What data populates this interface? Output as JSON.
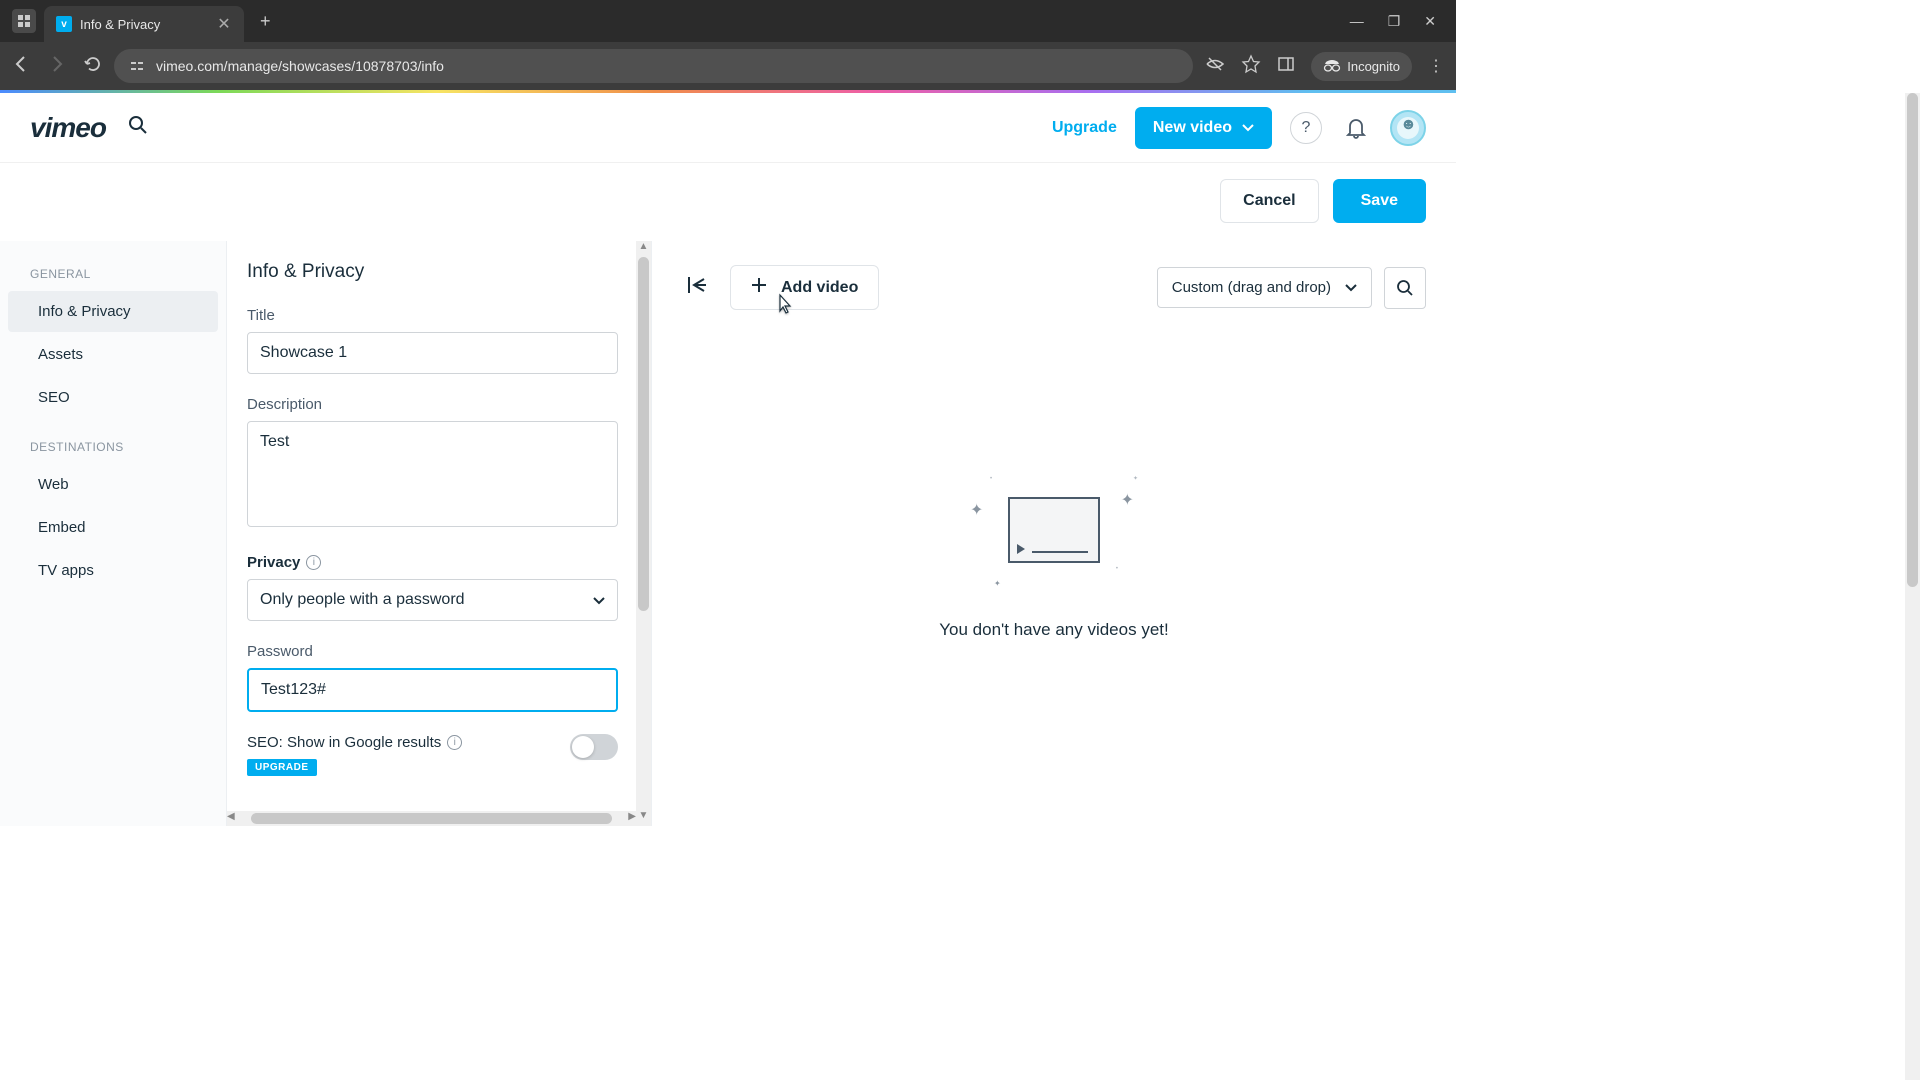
{
  "browser": {
    "tab_title": "Info & Privacy",
    "url": "vimeo.com/manage/showcases/10878703/info",
    "incognito_label": "Incognito"
  },
  "header": {
    "logo_text": "vimeo",
    "upgrade_label": "Upgrade",
    "new_video_label": "New video"
  },
  "actions": {
    "cancel": "Cancel",
    "save": "Save"
  },
  "sidebar": {
    "section_general": "GENERAL",
    "section_destinations": "DESTINATIONS",
    "items_general": [
      {
        "label": "Info & Privacy",
        "active": true
      },
      {
        "label": "Assets",
        "active": false
      },
      {
        "label": "SEO",
        "active": false
      }
    ],
    "items_destinations": [
      {
        "label": "Web"
      },
      {
        "label": "Embed"
      },
      {
        "label": "TV apps"
      }
    ]
  },
  "form": {
    "heading": "Info & Privacy",
    "title_label": "Title",
    "title_value": "Showcase 1",
    "description_label": "Description",
    "description_value": "Test",
    "privacy_label": "Privacy",
    "privacy_value": "Only people with a password",
    "password_label": "Password",
    "password_value": "Test123#",
    "seo_label": "SEO: Show in Google results",
    "upgrade_badge": "UPGRADE"
  },
  "videos": {
    "add_video_label": "Add video",
    "sort_value": "Custom (drag and drop)",
    "empty_text": "You don't have any videos yet!"
  }
}
